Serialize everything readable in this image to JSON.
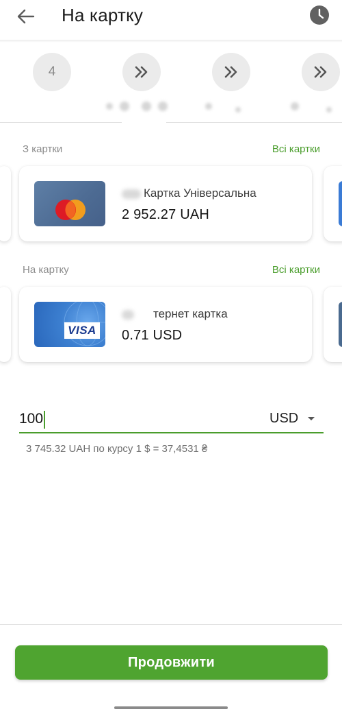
{
  "header": {
    "title": "На картку"
  },
  "recent": {
    "first_number": "4"
  },
  "from_section": {
    "label": "З картки",
    "all_cards_link": "Всі картки",
    "card": {
      "name": "Картка Універсальна",
      "balance": "2 952.27 UAH",
      "brand": "mastercard"
    }
  },
  "to_section": {
    "label": "На картку",
    "all_cards_link": "Всі картки",
    "card": {
      "name": "тернет картка",
      "balance": "0.71 USD",
      "brand": "VISA"
    }
  },
  "amount": {
    "value": "100",
    "currency": "USD",
    "rate_note": "3 745.32 UAH по курсу 1 $ = 37,4531 ₴"
  },
  "actions": {
    "continue_label": "Продовжити"
  },
  "colors": {
    "accent": "#4fa430",
    "link": "#4a9d2c"
  }
}
